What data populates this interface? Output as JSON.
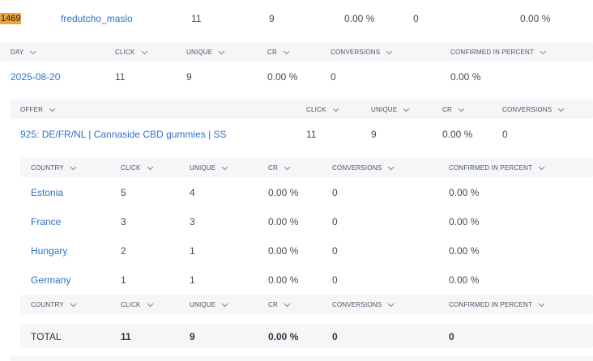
{
  "top_row": {
    "id": "1469",
    "name": "fredutcho_maslo",
    "click": "11",
    "unique": "9",
    "cr": "0.00 %",
    "conversions": "0",
    "confirmed_percent": "0.00 %"
  },
  "day_table": {
    "headers": [
      "DAY",
      "CLICK",
      "UNIQUE",
      "CR",
      "CONVERSIONS",
      "CONFIRMED IN PERCENT"
    ],
    "row": {
      "day": "2025-08-20",
      "click": "11",
      "unique": "9",
      "cr": "0.00 %",
      "conversions": "0",
      "confirmed_percent": "0.00 %"
    }
  },
  "offer_table": {
    "headers": [
      "OFFER",
      "CLICK",
      "UNIQUE",
      "CR",
      "CONVERSIONS"
    ],
    "row": {
      "offer": "925: DE/FR/NL | Cannaside CBD gummies | SS",
      "click": "11",
      "unique": "9",
      "cr": "0.00 %",
      "conversions": "0"
    }
  },
  "country_table": {
    "headers": [
      "COUNTRY",
      "CLICK",
      "UNIQUE",
      "CR",
      "CONVERSIONS",
      "CONFIRMED IN PERCENT"
    ],
    "rows": [
      {
        "country": "Estonia",
        "click": "5",
        "unique": "4",
        "cr": "0.00 %",
        "conversions": "0",
        "confirmed_percent": "0.00 %"
      },
      {
        "country": "France",
        "click": "3",
        "unique": "3",
        "cr": "0.00 %",
        "conversions": "0",
        "confirmed_percent": "0.00 %"
      },
      {
        "country": "Hungary",
        "click": "2",
        "unique": "1",
        "cr": "0.00 %",
        "conversions": "0",
        "confirmed_percent": "0.00 %"
      },
      {
        "country": "Germany",
        "click": "1",
        "unique": "1",
        "cr": "0.00 %",
        "conversions": "0",
        "confirmed_percent": "0.00 %"
      }
    ],
    "total": {
      "label": "TOTAL",
      "click": "11",
      "unique": "9",
      "cr": "0.00 %",
      "conversions": "0",
      "confirmed_percent": "0"
    }
  },
  "colors": {
    "link": "#2f72c4",
    "badge": "#f0a23a",
    "header_bg": "#f5f6f8"
  },
  "icons": {
    "sort": "chevron-down-icon"
  }
}
